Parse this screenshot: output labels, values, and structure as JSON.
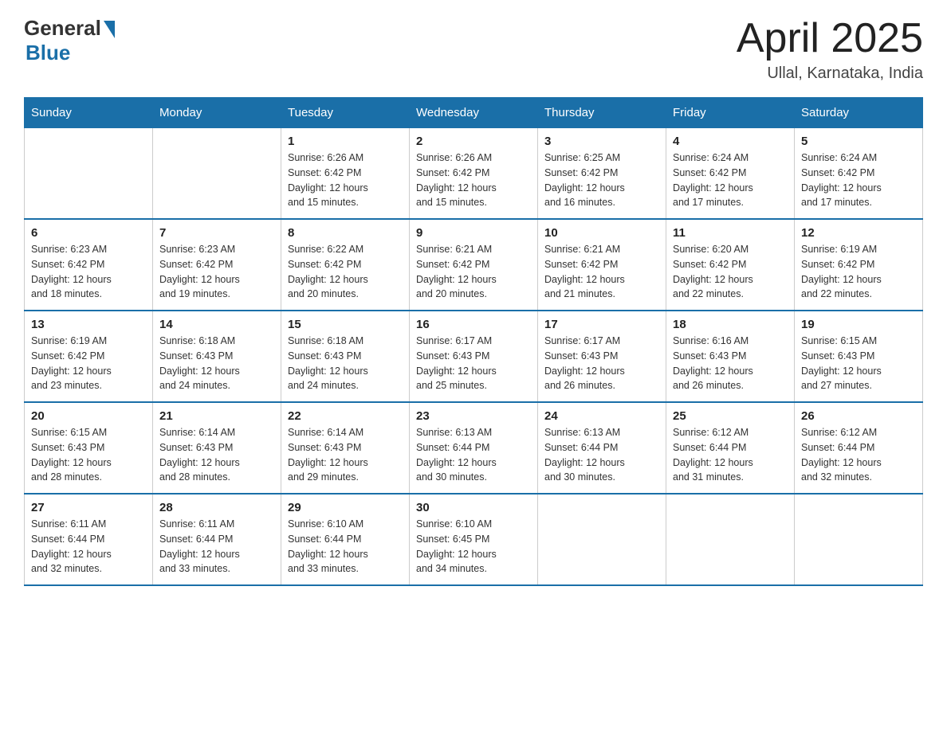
{
  "header": {
    "logo_general": "General",
    "logo_blue": "Blue",
    "month_title": "April 2025",
    "location": "Ullal, Karnataka, India"
  },
  "weekdays": [
    "Sunday",
    "Monday",
    "Tuesday",
    "Wednesday",
    "Thursday",
    "Friday",
    "Saturday"
  ],
  "weeks": [
    [
      {
        "day": "",
        "info": []
      },
      {
        "day": "",
        "info": []
      },
      {
        "day": "1",
        "info": [
          "Sunrise: 6:26 AM",
          "Sunset: 6:42 PM",
          "Daylight: 12 hours",
          "and 15 minutes."
        ]
      },
      {
        "day": "2",
        "info": [
          "Sunrise: 6:26 AM",
          "Sunset: 6:42 PM",
          "Daylight: 12 hours",
          "and 15 minutes."
        ]
      },
      {
        "day": "3",
        "info": [
          "Sunrise: 6:25 AM",
          "Sunset: 6:42 PM",
          "Daylight: 12 hours",
          "and 16 minutes."
        ]
      },
      {
        "day": "4",
        "info": [
          "Sunrise: 6:24 AM",
          "Sunset: 6:42 PM",
          "Daylight: 12 hours",
          "and 17 minutes."
        ]
      },
      {
        "day": "5",
        "info": [
          "Sunrise: 6:24 AM",
          "Sunset: 6:42 PM",
          "Daylight: 12 hours",
          "and 17 minutes."
        ]
      }
    ],
    [
      {
        "day": "6",
        "info": [
          "Sunrise: 6:23 AM",
          "Sunset: 6:42 PM",
          "Daylight: 12 hours",
          "and 18 minutes."
        ]
      },
      {
        "day": "7",
        "info": [
          "Sunrise: 6:23 AM",
          "Sunset: 6:42 PM",
          "Daylight: 12 hours",
          "and 19 minutes."
        ]
      },
      {
        "day": "8",
        "info": [
          "Sunrise: 6:22 AM",
          "Sunset: 6:42 PM",
          "Daylight: 12 hours",
          "and 20 minutes."
        ]
      },
      {
        "day": "9",
        "info": [
          "Sunrise: 6:21 AM",
          "Sunset: 6:42 PM",
          "Daylight: 12 hours",
          "and 20 minutes."
        ]
      },
      {
        "day": "10",
        "info": [
          "Sunrise: 6:21 AM",
          "Sunset: 6:42 PM",
          "Daylight: 12 hours",
          "and 21 minutes."
        ]
      },
      {
        "day": "11",
        "info": [
          "Sunrise: 6:20 AM",
          "Sunset: 6:42 PM",
          "Daylight: 12 hours",
          "and 22 minutes."
        ]
      },
      {
        "day": "12",
        "info": [
          "Sunrise: 6:19 AM",
          "Sunset: 6:42 PM",
          "Daylight: 12 hours",
          "and 22 minutes."
        ]
      }
    ],
    [
      {
        "day": "13",
        "info": [
          "Sunrise: 6:19 AM",
          "Sunset: 6:42 PM",
          "Daylight: 12 hours",
          "and 23 minutes."
        ]
      },
      {
        "day": "14",
        "info": [
          "Sunrise: 6:18 AM",
          "Sunset: 6:43 PM",
          "Daylight: 12 hours",
          "and 24 minutes."
        ]
      },
      {
        "day": "15",
        "info": [
          "Sunrise: 6:18 AM",
          "Sunset: 6:43 PM",
          "Daylight: 12 hours",
          "and 24 minutes."
        ]
      },
      {
        "day": "16",
        "info": [
          "Sunrise: 6:17 AM",
          "Sunset: 6:43 PM",
          "Daylight: 12 hours",
          "and 25 minutes."
        ]
      },
      {
        "day": "17",
        "info": [
          "Sunrise: 6:17 AM",
          "Sunset: 6:43 PM",
          "Daylight: 12 hours",
          "and 26 minutes."
        ]
      },
      {
        "day": "18",
        "info": [
          "Sunrise: 6:16 AM",
          "Sunset: 6:43 PM",
          "Daylight: 12 hours",
          "and 26 minutes."
        ]
      },
      {
        "day": "19",
        "info": [
          "Sunrise: 6:15 AM",
          "Sunset: 6:43 PM",
          "Daylight: 12 hours",
          "and 27 minutes."
        ]
      }
    ],
    [
      {
        "day": "20",
        "info": [
          "Sunrise: 6:15 AM",
          "Sunset: 6:43 PM",
          "Daylight: 12 hours",
          "and 28 minutes."
        ]
      },
      {
        "day": "21",
        "info": [
          "Sunrise: 6:14 AM",
          "Sunset: 6:43 PM",
          "Daylight: 12 hours",
          "and 28 minutes."
        ]
      },
      {
        "day": "22",
        "info": [
          "Sunrise: 6:14 AM",
          "Sunset: 6:43 PM",
          "Daylight: 12 hours",
          "and 29 minutes."
        ]
      },
      {
        "day": "23",
        "info": [
          "Sunrise: 6:13 AM",
          "Sunset: 6:44 PM",
          "Daylight: 12 hours",
          "and 30 minutes."
        ]
      },
      {
        "day": "24",
        "info": [
          "Sunrise: 6:13 AM",
          "Sunset: 6:44 PM",
          "Daylight: 12 hours",
          "and 30 minutes."
        ]
      },
      {
        "day": "25",
        "info": [
          "Sunrise: 6:12 AM",
          "Sunset: 6:44 PM",
          "Daylight: 12 hours",
          "and 31 minutes."
        ]
      },
      {
        "day": "26",
        "info": [
          "Sunrise: 6:12 AM",
          "Sunset: 6:44 PM",
          "Daylight: 12 hours",
          "and 32 minutes."
        ]
      }
    ],
    [
      {
        "day": "27",
        "info": [
          "Sunrise: 6:11 AM",
          "Sunset: 6:44 PM",
          "Daylight: 12 hours",
          "and 32 minutes."
        ]
      },
      {
        "day": "28",
        "info": [
          "Sunrise: 6:11 AM",
          "Sunset: 6:44 PM",
          "Daylight: 12 hours",
          "and 33 minutes."
        ]
      },
      {
        "day": "29",
        "info": [
          "Sunrise: 6:10 AM",
          "Sunset: 6:44 PM",
          "Daylight: 12 hours",
          "and 33 minutes."
        ]
      },
      {
        "day": "30",
        "info": [
          "Sunrise: 6:10 AM",
          "Sunset: 6:45 PM",
          "Daylight: 12 hours",
          "and 34 minutes."
        ]
      },
      {
        "day": "",
        "info": []
      },
      {
        "day": "",
        "info": []
      },
      {
        "day": "",
        "info": []
      }
    ]
  ]
}
